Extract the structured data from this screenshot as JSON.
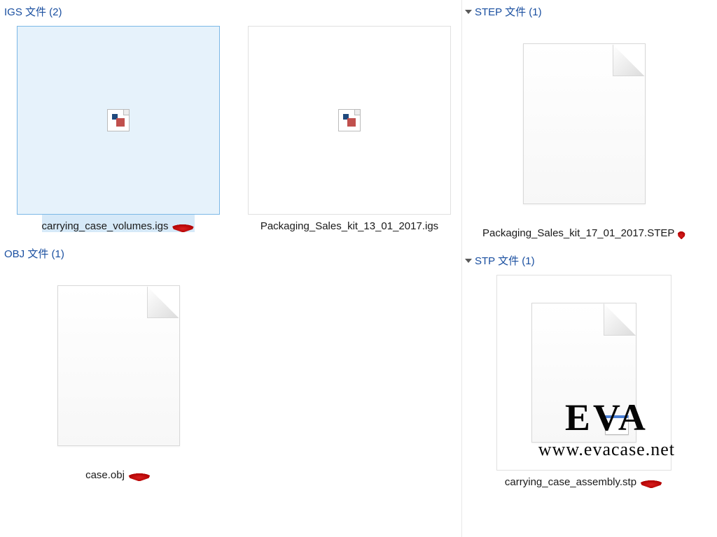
{
  "groups": {
    "igs": {
      "label": "IGS 文件 (2)"
    },
    "obj": {
      "label": "OBJ 文件 (1)"
    },
    "step": {
      "label": "STEP 文件 (1)"
    },
    "stp": {
      "label": "STP 文件 (1)"
    }
  },
  "files": {
    "igs": [
      {
        "name": "carrying_case_volumes.igs",
        "selected": true,
        "marked": true,
        "thumb": "missing"
      },
      {
        "name": "Packaging_Sales_kit_13_01_2017.igs",
        "selected": false,
        "marked": false,
        "thumb": "missing"
      }
    ],
    "obj": [
      {
        "name": "case.obj",
        "selected": false,
        "marked": true,
        "thumb": "blank-page"
      }
    ],
    "step": [
      {
        "name": "Packaging_Sales_kit_17_01_2017.STEP",
        "selected": false,
        "marked": true,
        "thumb": "blank-page"
      }
    ],
    "stp": [
      {
        "name": "carrying_case_assembly.stp",
        "selected": false,
        "marked": true,
        "thumb": "app-page"
      }
    ]
  },
  "watermark": {
    "brand": "EVA",
    "url": "www.evacase.net"
  }
}
